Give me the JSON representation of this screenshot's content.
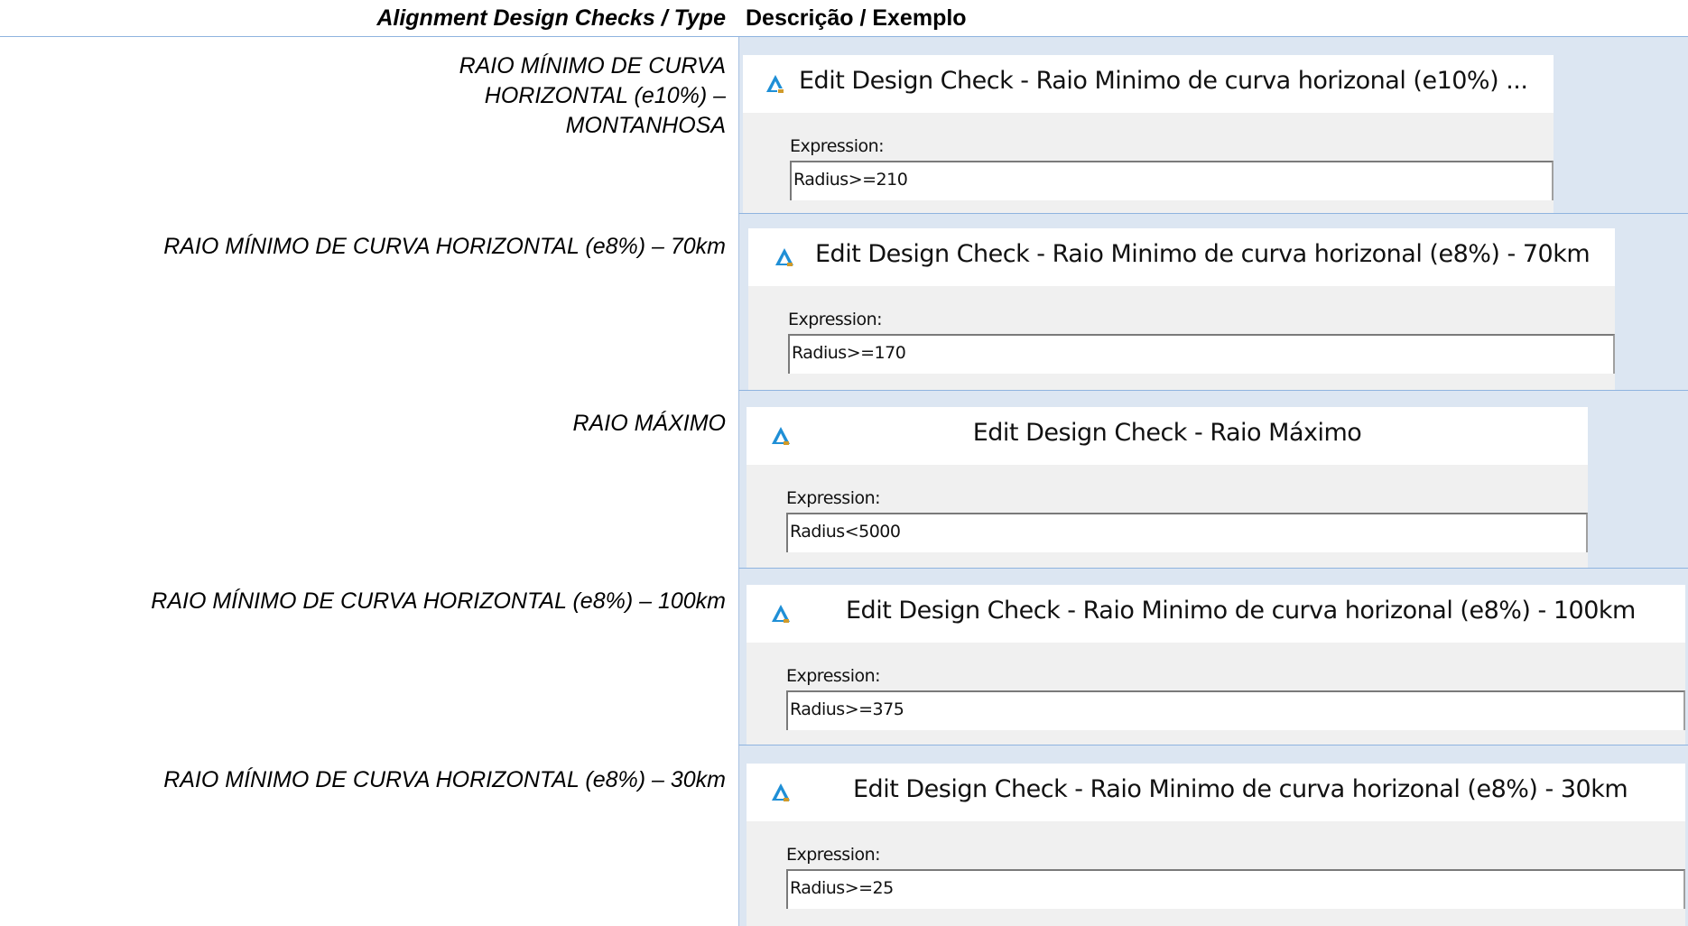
{
  "table": {
    "header": {
      "type_column": "Alignment Design Checks / Type",
      "description_column": "Descrição / Exemplo"
    },
    "rows": [
      {
        "type": "RAIO MÍNIMO DE CURVA HORIZONTAL (e10%) – MONTANHOSA",
        "dialog_title": "Edit Design Check - Raio Minimo de curva horizonal (e10%) ...",
        "expression_label": "Expression:",
        "expression_value": "Radius>=210"
      },
      {
        "type": "RAIO MÍNIMO DE CURVA HORIZONTAL (e8%) – 70km",
        "dialog_title": "Edit Design Check - Raio Minimo de curva horizonal (e8%) - 70km",
        "expression_label": "Expression:",
        "expression_value": "Radius>=170"
      },
      {
        "type": "RAIO MÁXIMO",
        "dialog_title": "Edit Design Check - Raio Máximo",
        "expression_label": "Expression:",
        "expression_value": "Radius<5000"
      },
      {
        "type": "RAIO MÍNIMO DE CURVA HORIZONTAL (e8%) – 100km",
        "dialog_title": "Edit Design Check - Raio Minimo de curva horizonal (e8%) - 100km",
        "expression_label": "Expression:",
        "expression_value": "Radius>=375"
      },
      {
        "type": "RAIO MÍNIMO DE CURVA HORIZONTAL (e8%) – 30km",
        "dialog_title": "Edit Design Check - Raio Minimo de curva horizonal (e8%) - 30km",
        "expression_label": "Expression:",
        "expression_value": "Radius>=25"
      }
    ]
  },
  "icons": {
    "dialog_icon": "autocad-civil3d-app-icon"
  },
  "colors": {
    "cell_background": "#dce6f2",
    "row_border": "#8fb4df",
    "dialog_background": "#f0f0f0",
    "icon_blue": "#1f8fd6"
  }
}
